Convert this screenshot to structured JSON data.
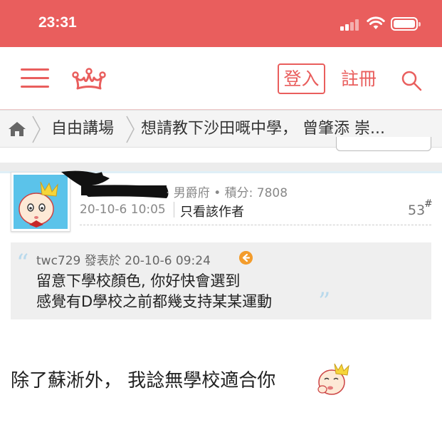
{
  "status_bar": {
    "time": "23:31"
  },
  "header": {
    "menu_icon": "hamburger-menu-icon",
    "logo_icon": "crown-icon",
    "login_label": "登入",
    "register_label": "註冊",
    "search_icon": "search-icon"
  },
  "breadcrumb": {
    "home_icon": "home-icon",
    "forum": "自由講場",
    "thread": "想請教下沙田嘅中學， 曾肇添 崇..."
  },
  "post": {
    "user_rank": "· 男爵府 • 積分: 7808",
    "date": "20-10-6 10:05",
    "author_only": "只看該作者",
    "floor": "53",
    "floor_mark": "#",
    "quote": {
      "author_line": "twc729 發表於 20-10-6 09:24",
      "lines": [
        "留意下學校顏色, 你好快會選到",
        "感覺有D學校之前都幾支持某某運動"
      ]
    },
    "body": "除了蘇淅外， 我諗無學校適合你"
  },
  "colors": {
    "accent": "#e95e5d",
    "quote_bg": "#efefef",
    "quote_mark": "#b9d9ec",
    "avatar_bg": "#5bc3ea",
    "jump_icon": "#f39c2c"
  }
}
